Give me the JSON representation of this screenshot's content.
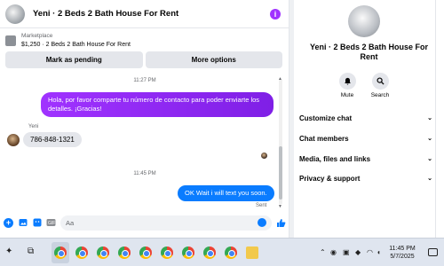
{
  "header": {
    "title": "Yeni · 2 Beds 2 Bath House For Rent",
    "info_icon_glyph": "i",
    "accent_color": "#a033ff"
  },
  "marketplace": {
    "label": "Marketplace",
    "item": "$1,250 · 2 Beds 2 Bath House For Rent",
    "mark_pending": "Mark as pending",
    "more_options": "More options"
  },
  "messages": {
    "ts1": "11:27 PM",
    "out1": "Hola, por favor comparte tu número de contacto para poder enviarte los detalles. ¡Gracias!",
    "sender": "Yeni",
    "in1": "786-848-1321",
    "ts2": "11:45 PM",
    "out2": "OK Wait i will text you soon.",
    "status": "Sent",
    "out_color": "#0a7cff"
  },
  "composer": {
    "placeholder": "Aa",
    "icons": [
      "plus-icon",
      "image-icon",
      "sticker-icon",
      "gif-icon",
      "emoji-icon",
      "thumbs-up-icon"
    ]
  },
  "side": {
    "title": "Yeni · 2 Beds 2 Bath House For Rent",
    "mute": "Mute",
    "search": "Search",
    "menu": [
      "Customize chat",
      "Chat members",
      "Media, files and links",
      "Privacy & support"
    ]
  },
  "taskbar": {
    "time": "11:45 PM",
    "date": "5/7/2025"
  }
}
